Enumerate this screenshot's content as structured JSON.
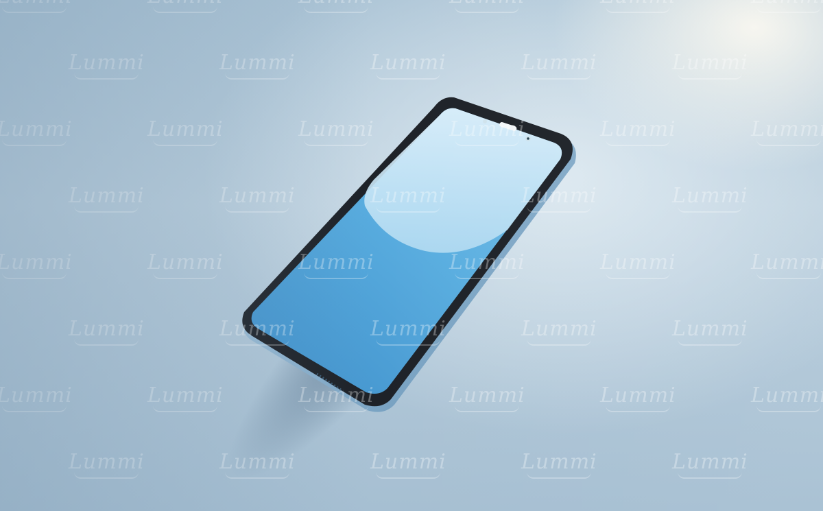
{
  "image": {
    "subject": "smartphone",
    "watermark": "Lummi",
    "colors": {
      "background_light": "#eef2f3",
      "background_mid": "#b8cddc",
      "background_dark": "#9fb8cb",
      "screen_blue": "#4fa3da",
      "screen_highlight": "#c9e6f6",
      "bezel": "#1e2228",
      "frame": "#7fa9c9"
    }
  }
}
